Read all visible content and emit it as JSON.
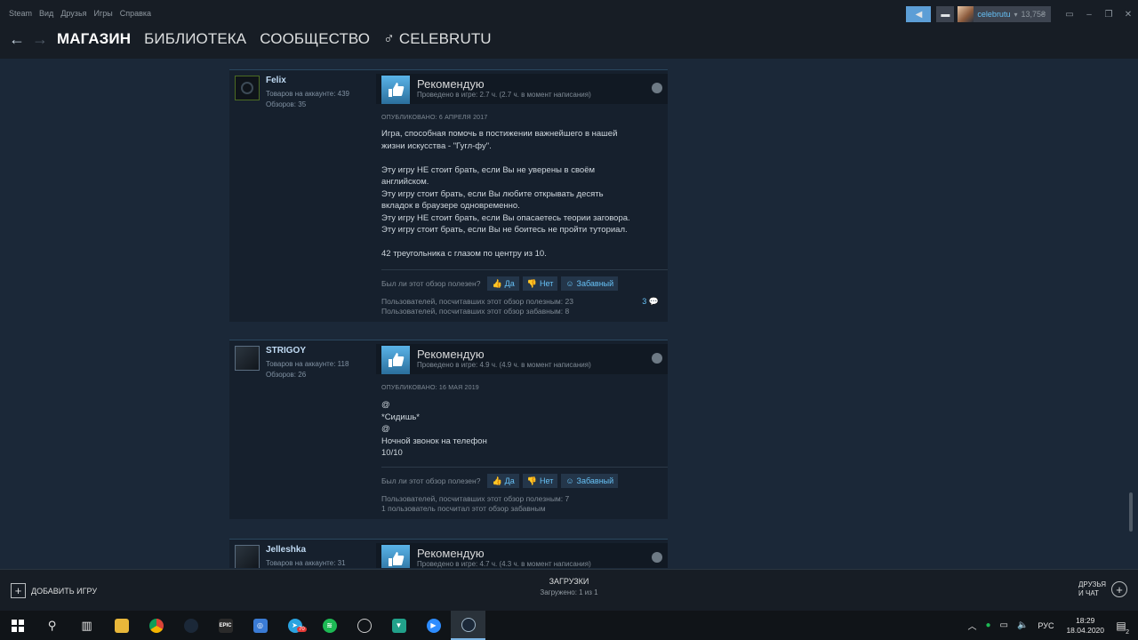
{
  "menu": [
    "Steam",
    "Вид",
    "Друзья",
    "Игры",
    "Справка"
  ],
  "header": {
    "username": "celebrutu",
    "balance": "13,75₴"
  },
  "nav": {
    "store": "МАГАЗИН",
    "library": "БИБЛИОТЕКА",
    "community": "СООБЩЕСТВО",
    "profile": "♂ CELEBRUTU"
  },
  "reviews": [
    {
      "author": "Felix",
      "products": "Товаров на аккаунте: 439",
      "reviews_count": "Обзоров: 35",
      "verdict": "Рекомендую",
      "hours": "Проведено в игре: 2.7 ч. (2.7 ч. в момент написания)",
      "posted": "ОПУБЛИКОВАНО: 6 АПРЕЛЯ 2017",
      "lines": [
        "Игра, способная помочь в постижении важнейшего в нашей",
        "жизни искусства - \"Гугл-фу\".",
        "",
        "Эту игру НЕ стоит брать, если Вы не уверены в своём",
        "английском.",
        "Эту игру стоит брать, если Вы любите открывать десять",
        "вкладок в браузере одновременно.",
        "Эту игру НЕ стоит брать, если Вы опасаетесь теории заговора.",
        "Эту игру стоит брать, если Вы не боитесь не пройти туториал.",
        "",
        "42 треугольника с глазом по центру из 10."
      ],
      "helpful_q": "Был ли этот обзор полезен?",
      "yes": "Да",
      "no": "Нет",
      "funny": "Забавный",
      "count_helpful": "Пользователей, посчитавших этот обзор полезным: 23",
      "count_funny": "Пользователей, посчитавших этот обзор забавным: 8",
      "comments": "3"
    },
    {
      "author": "STRIGOY",
      "products": "Товаров на аккаунте: 118",
      "reviews_count": "Обзоров: 26",
      "verdict": "Рекомендую",
      "hours": "Проведено в игре: 4.9 ч. (4.9 ч. в момент написания)",
      "posted": "ОПУБЛИКОВАНО: 16 МАЯ 2019",
      "lines": [
        "@",
        "*Сидишь*",
        "@",
        "Ночной звонок на телефон",
        "10/10"
      ],
      "helpful_q": "Был ли этот обзор полезен?",
      "yes": "Да",
      "no": "Нет",
      "funny": "Забавный",
      "count_helpful": "Пользователей, посчитавших этот обзор полезным: 7",
      "count_funny": "1 пользователь посчитал этот обзор забавным"
    },
    {
      "author": "Jelleshka",
      "products": "Товаров на аккаунте: 31",
      "verdict": "Рекомендую",
      "hours": "Проведено в игре: 4.7 ч. (4.3 ч. в момент написания)"
    }
  ],
  "bottom": {
    "add_game": "ДОБАВИТЬ ИГРУ",
    "downloads": "ЗАГРУЗКИ",
    "downloads_status": "Загружено: 1 из 1",
    "friends_1": "ДРУЗЬЯ",
    "friends_2": "И ЧАТ"
  },
  "taskbar": {
    "lang": "РУС",
    "time": "18:29",
    "date": "18.04.2020",
    "telegram_badge": "70",
    "notif_count": "2"
  },
  "colors": {
    "bg": "#1b2838",
    "accent": "#67c1f5",
    "header": "#171d25"
  }
}
